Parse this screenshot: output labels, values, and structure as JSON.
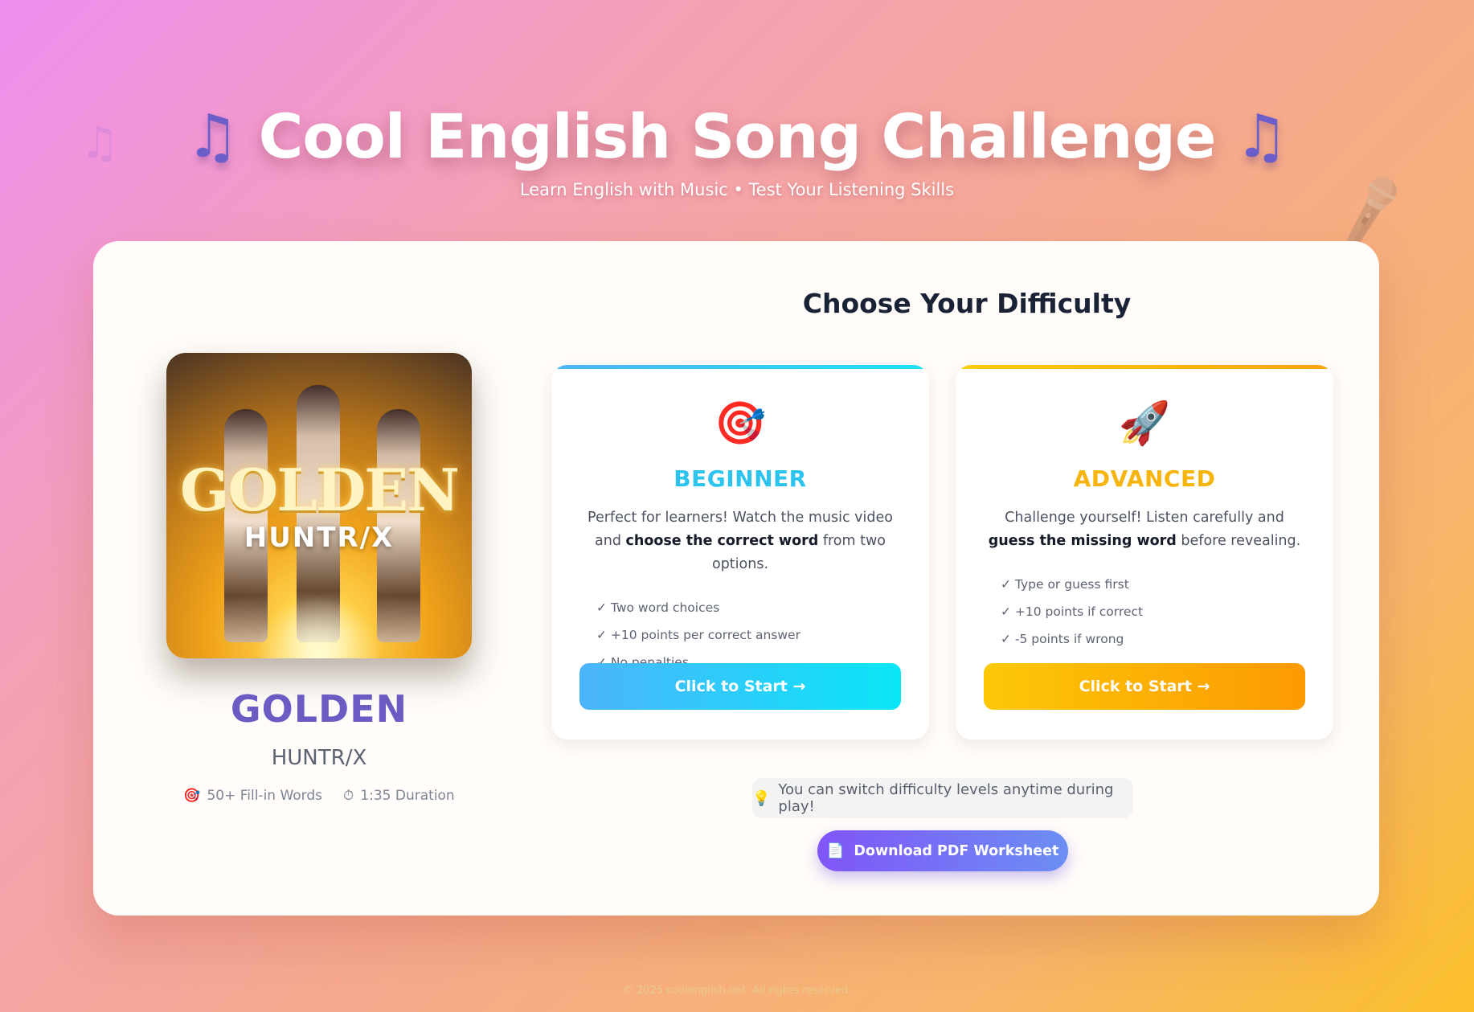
{
  "header": {
    "title": "Cool English Song Challenge",
    "subtitle": "Learn English with Music • Test Your Listening Skills",
    "title_icon": "music-note-icon"
  },
  "song": {
    "cover_title": "GOLDEN",
    "cover_artist": "HUNTR/X",
    "title": "GOLDEN",
    "artist": "HUNTR/X",
    "meta": [
      {
        "icon": "target-icon",
        "glyph": "🎯",
        "text": "50+ Fill-in Words"
      },
      {
        "icon": "stopwatch-icon",
        "glyph": "⏱",
        "text": "1:35 Duration"
      }
    ]
  },
  "difficulty": {
    "heading": "Choose Your Difficulty",
    "beginner": {
      "icon": "target-icon",
      "glyph": "🎯",
      "name": "BEGINNER",
      "desc_1": "Perfect for learners! Watch the music video and ",
      "desc_bold": "choose the correct word",
      "desc_2": " from two options.",
      "features": [
        "✓ Two word choices",
        "✓ +10 points per correct answer",
        "✓ No penalties"
      ],
      "button": "Click to Start →"
    },
    "advanced": {
      "icon": "rocket-icon",
      "glyph": "🚀",
      "name": "ADVANCED",
      "desc_1": "Challenge yourself! Listen carefully and ",
      "desc_bold": "guess the missing word",
      "desc_2": " before revealing.",
      "features": [
        "✓ Type or guess first",
        "✓ +10 points if correct",
        "✓ -5 points if wrong"
      ],
      "button": "Click to Start →"
    },
    "tip": {
      "icon": "lightbulb-icon",
      "glyph": "💡",
      "text": "You can switch difficulty levels anytime during play!"
    },
    "pdf": {
      "icon": "document-icon",
      "glyph": "📄",
      "text": "Download PDF Worksheet"
    }
  },
  "footer": "© 2025 coolenglish.net. All rights reserved.",
  "colors": {
    "beginner_accent": "#2cc3ef",
    "advanced_accent": "#f6b40d",
    "song_title": "#6b5cc4",
    "pdf_button": "#7a5af6"
  }
}
